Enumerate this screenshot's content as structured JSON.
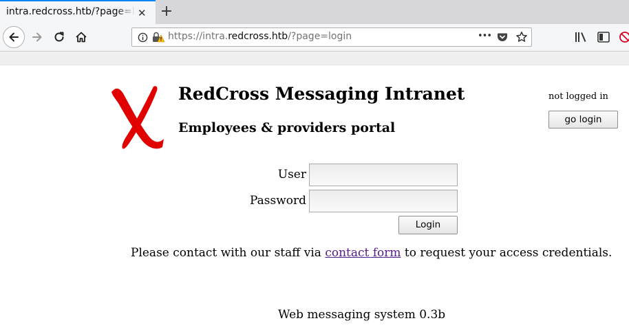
{
  "browser": {
    "tab_title": "intra.redcross.htb/?page=login",
    "tab_close": "✕",
    "new_tab": "+",
    "url_prefix": "https://intra.",
    "url_domain": "redcross.htb",
    "url_path": "/?page=login",
    "page_actions": "•••"
  },
  "page": {
    "title": "RedCross Messaging Intranet",
    "subtitle": "Employees & providers portal",
    "login_status": "not logged in",
    "go_login_label": "go login",
    "logo_color": "#e00000"
  },
  "form": {
    "user_label": "User",
    "user_value": "",
    "password_label": "Password",
    "password_value": "",
    "submit_label": "Login"
  },
  "contact": {
    "before": "Please contact with our staff via ",
    "link": "contact form",
    "after": " to request your access credentials."
  },
  "footer": {
    "text": "Web messaging system 0.3b"
  }
}
